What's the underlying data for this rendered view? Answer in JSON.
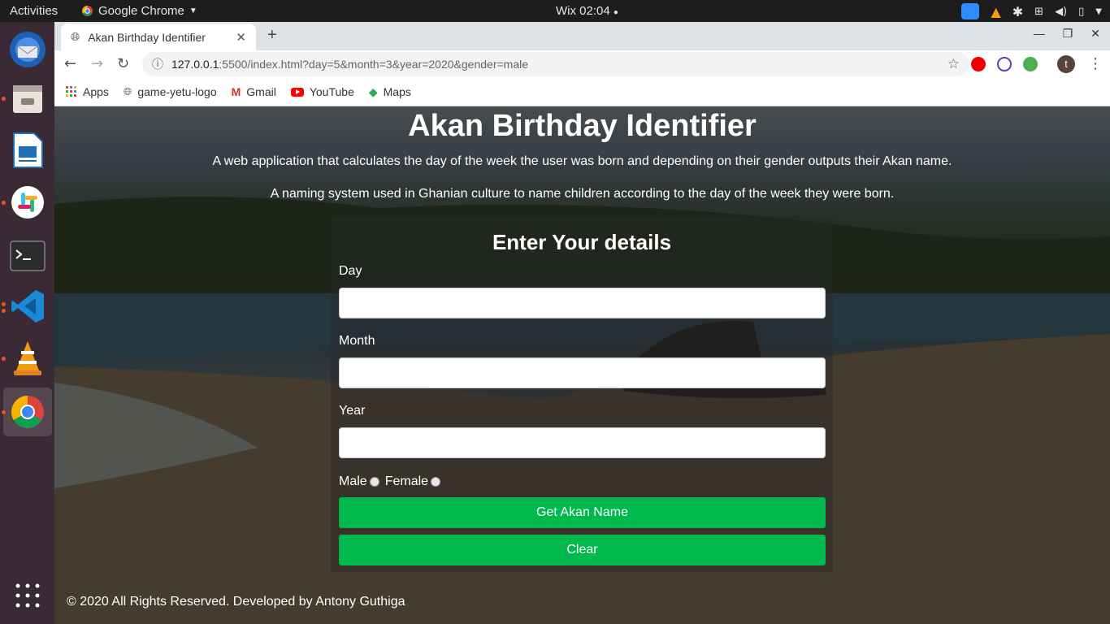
{
  "os_bar": {
    "activities": "Activities",
    "app_menu": "Google Chrome",
    "clock": "Wix 02:04"
  },
  "dock": {
    "items": [
      "thunderbird-icon",
      "files-icon",
      "libreoffice-impress-icon",
      "slack-icon",
      "terminal-icon",
      "vscode-icon",
      "vlc-icon",
      "chrome-icon",
      "app-grid-icon"
    ]
  },
  "browser": {
    "tab_title": "Akan Birthday Identifier",
    "url_host": "127.0.0.1",
    "url_path": ":5500/index.html?day=5&month=3&year=2020&gender=male",
    "avatar_letter": "t",
    "bookmarks": [
      "Apps",
      "game-yetu-logo",
      "Gmail",
      "YouTube",
      "Maps"
    ]
  },
  "page": {
    "title": "Akan Birthday Identifier",
    "description1": "A web application that calculates the day of the week the user was born and depending on their gender outputs their Akan name.",
    "description2": "A naming system used in Ghanian culture to name children according to the day of the week they were born.",
    "form": {
      "heading": "Enter Your details",
      "day_label": "Day",
      "day_value": "",
      "month_label": "Month",
      "month_value": "",
      "year_label": "Year",
      "year_value": "",
      "male_label": "Male",
      "female_label": "Female",
      "submit_label": "Get Akan Name",
      "clear_label": "Clear"
    },
    "footer": "© 2020 All Rights Reserved. Developed by Antony Guthiga"
  },
  "colors": {
    "button_green": "#00b84b",
    "ubuntu_orange": "#e95420"
  }
}
